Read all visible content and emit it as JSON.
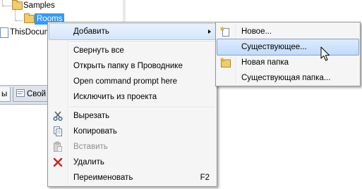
{
  "tree": {
    "items": [
      {
        "label": "Samples"
      },
      {
        "label": "Rooms"
      },
      {
        "label": "ThisDocum"
      }
    ]
  },
  "bottom_tabs": [
    {
      "label": "ы"
    },
    {
      "label": "Свой"
    }
  ],
  "context_menu": {
    "items": [
      {
        "label": "Добавить",
        "has_submenu": true
      },
      {
        "label": "Свернуть все"
      },
      {
        "label": "Открыть папку в Проводнике"
      },
      {
        "label": "Open command prompt here"
      },
      {
        "label": "Исключить из проекта"
      },
      {
        "label": "Вырезать",
        "icon": "scissors-icon"
      },
      {
        "label": "Копировать",
        "icon": "copy-icon"
      },
      {
        "label": "Вставить",
        "icon": "paste-icon",
        "disabled": true
      },
      {
        "label": "Удалить",
        "icon": "delete-x-icon"
      },
      {
        "label": "Переименовать",
        "shortcut": "F2"
      }
    ]
  },
  "submenu": {
    "items": [
      {
        "label": "Новое...",
        "icon": "new-item-icon"
      },
      {
        "label": "Существующее..."
      },
      {
        "label": "Новая папка",
        "icon": "new-folder-icon"
      },
      {
        "label": "Существующая папка..."
      }
    ]
  },
  "colors": {
    "selection": "#3399ff",
    "menu_background": "#f5f5f5",
    "hover_border": "#7da2ce",
    "delete_red": "#cc1f1f"
  }
}
